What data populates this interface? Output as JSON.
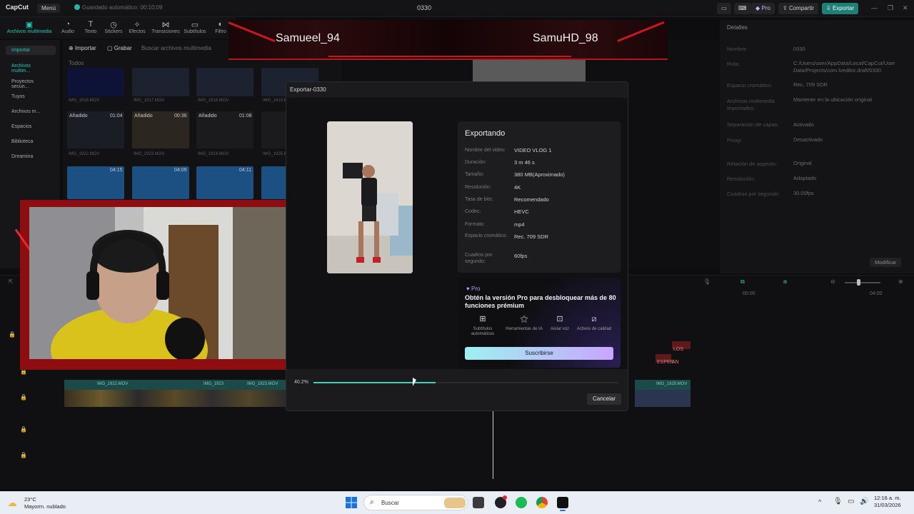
{
  "app": {
    "logo": "CapCut",
    "menu": "Menú",
    "autosave": "Guardado automático: 00:10:09",
    "project_title": "0330",
    "pro_label": "Pro",
    "share_label": "Compartir",
    "export_label": "Exportar"
  },
  "toolbar": {
    "tools": [
      "Archivos multimedia",
      "Audio",
      "Texto",
      "Stickers",
      "Efectos",
      "Transiciones",
      "Subtítulos",
      "Filtro"
    ]
  },
  "media_panel": {
    "nav": [
      "Importar",
      "Archivos multim...",
      "Proyectos secun...",
      "Tuyos",
      "Archivos m...",
      "Espacios",
      "Biblioteca",
      "Dreamina"
    ],
    "import_label": "Importar",
    "record_label": "Grabar",
    "search_placeholder": "Buscar archivos multimedia",
    "filter_all": "Todos",
    "added_label": "Añadido",
    "thumbs": [
      "IMG_1916.MOV",
      "IMG_1917.MOV",
      "IMG_1918.MOV",
      "IMG_1919.MOV",
      "IMG_1922.MOV",
      "IMG_1923.MOV",
      "IMG_1924.MOV",
      "IMG_1925.MOV"
    ],
    "durations": [
      "01:04",
      "00:36",
      "01:08",
      "04:15",
      "04:09",
      "04:11"
    ]
  },
  "stream_overlay": {
    "player_left": "Samueel_94",
    "player_right": "SamuHD_98"
  },
  "details": {
    "title": "Detalles",
    "rows": [
      {
        "label": "Nombre:",
        "value": "0330"
      },
      {
        "label": "Ruta:",
        "value": "C:/Users/user/AppData/Local/CapCut/User Data/Projects/com.lveditor.draft/0330"
      },
      {
        "label": "Espacio cromático:",
        "value": "Rec. 709 SDR"
      },
      {
        "label": "Archivos multimedia importados:",
        "value": "Mantener en la ubicación original"
      },
      {
        "label": "Separación de capas:",
        "value": "Activado"
      },
      {
        "label": "Proxy:",
        "value": "Desactivado"
      },
      {
        "label": "Relación de aspecto:",
        "value": "Original"
      },
      {
        "label": "Resolución:",
        "value": "Adaptado"
      },
      {
        "label": "Cuadros por segundo:",
        "value": "30.00fps"
      }
    ],
    "modify_label": "Modificar"
  },
  "timeline": {
    "clips": [
      "IMG_1922.MOV",
      "IMG_1922.MOV",
      "IMG_1923",
      "IMG_1923.MOV",
      "IMG_1923.MOV",
      "IMG_1929.MOV"
    ],
    "times": [
      "00:00",
      "04:00"
    ],
    "text_clips": [
      "LOS AN",
      "ESPER"
    ]
  },
  "export_dialog": {
    "title": "Exportar-0330",
    "heading": "Exportando",
    "rows": [
      {
        "label": "Nombre del video:",
        "value": "VIDEO VLOG 1"
      },
      {
        "label": "Duración:",
        "value": "3 m 46 s"
      },
      {
        "label": "Tamaño:",
        "value": "380 MB(Aproximado)"
      },
      {
        "label": "Resolución:",
        "value": "4K"
      },
      {
        "label": "Tasa de bits:",
        "value": "Recomendado"
      },
      {
        "label": "Codec:",
        "value": "HEVC"
      },
      {
        "label": "Formato:",
        "value": "mp4"
      },
      {
        "label": "Espacio cromático:",
        "value": "Rec. 709 SDR"
      },
      {
        "label": "Cuadros por segundo:",
        "value": "60fps"
      }
    ],
    "pro_badge": "Pro",
    "pro_message": "Obtén la versión Pro para desbloquear más de 80 funciones prémium",
    "features": [
      "Subtítulos automáticos",
      "Herramientas de IA",
      "Aislar voz",
      "Activos de calidad"
    ],
    "subscribe_label": "Suscribirse",
    "progress_label": "40.2%",
    "progress": 0.402,
    "cancel_label": "Cancelar"
  },
  "taskbar": {
    "temperature": "23°C",
    "weather": "Mayorm. nublado",
    "search_label": "Buscar",
    "time": "12:16 a. m.",
    "date": "31/03/2026"
  },
  "colors": {
    "accent": "#23c6b4",
    "overlay_red": "#c41a20",
    "pro_purple": "#b49cff"
  }
}
